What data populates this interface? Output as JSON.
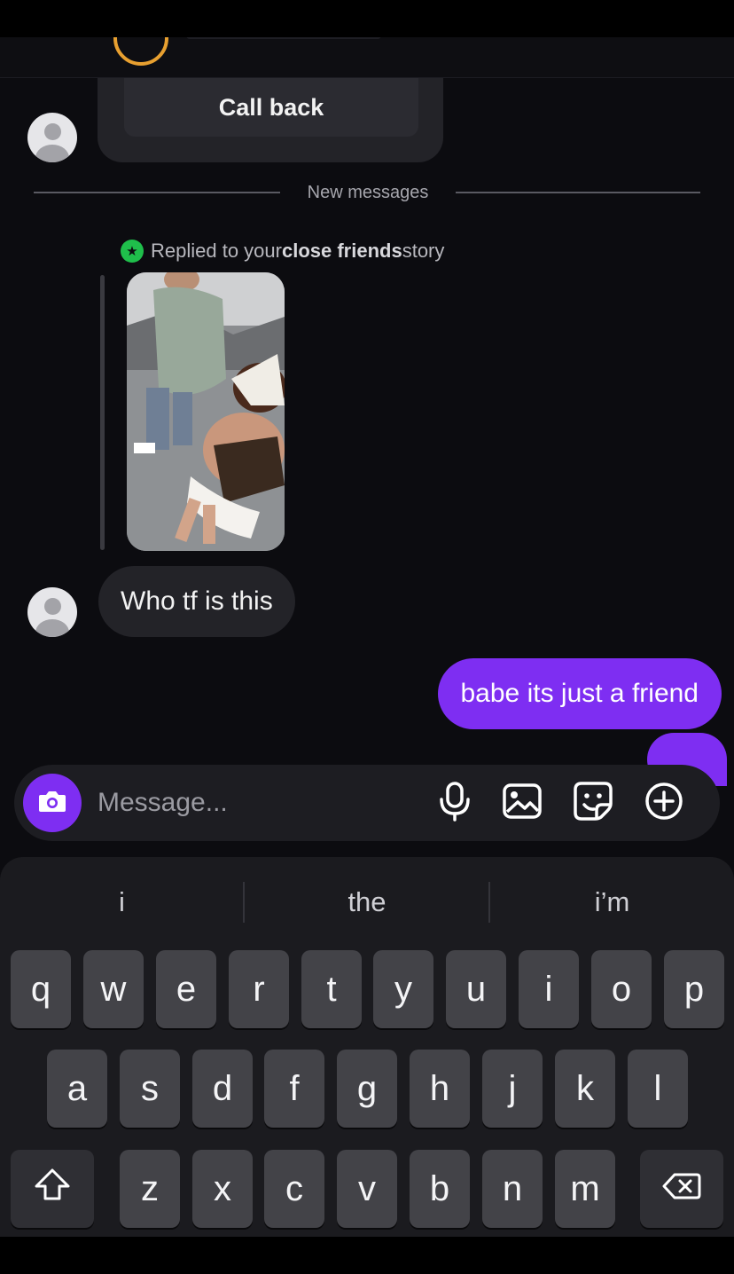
{
  "thread": {
    "call_back_label": "Call back",
    "new_messages_label": "New messages",
    "reply_note": {
      "prefix": "Replied to your ",
      "emphasis": "close friends",
      "suffix": " story"
    },
    "messages": [
      {
        "direction": "incoming",
        "text": "Who tf is this"
      },
      {
        "direction": "outgoing",
        "text": "babe its just a friend"
      }
    ]
  },
  "composer": {
    "placeholder": "Message...",
    "icons": [
      "camera-icon",
      "microphone-icon",
      "gallery-icon",
      "sticker-icon",
      "plus-circle-icon"
    ]
  },
  "keyboard": {
    "suggestions": [
      "i",
      "the",
      "i’m"
    ],
    "row1": [
      "q",
      "w",
      "e",
      "r",
      "t",
      "y",
      "u",
      "i",
      "o",
      "p"
    ],
    "row2": [
      "a",
      "s",
      "d",
      "f",
      "g",
      "h",
      "j",
      "k",
      "l"
    ],
    "row3": [
      "z",
      "x",
      "c",
      "v",
      "b",
      "n",
      "m"
    ]
  },
  "colors": {
    "accent": "#7e2ef2",
    "background": "#0c0c10",
    "incoming_bubble": "#232328",
    "close_friends_badge": "#1fbf4b"
  }
}
